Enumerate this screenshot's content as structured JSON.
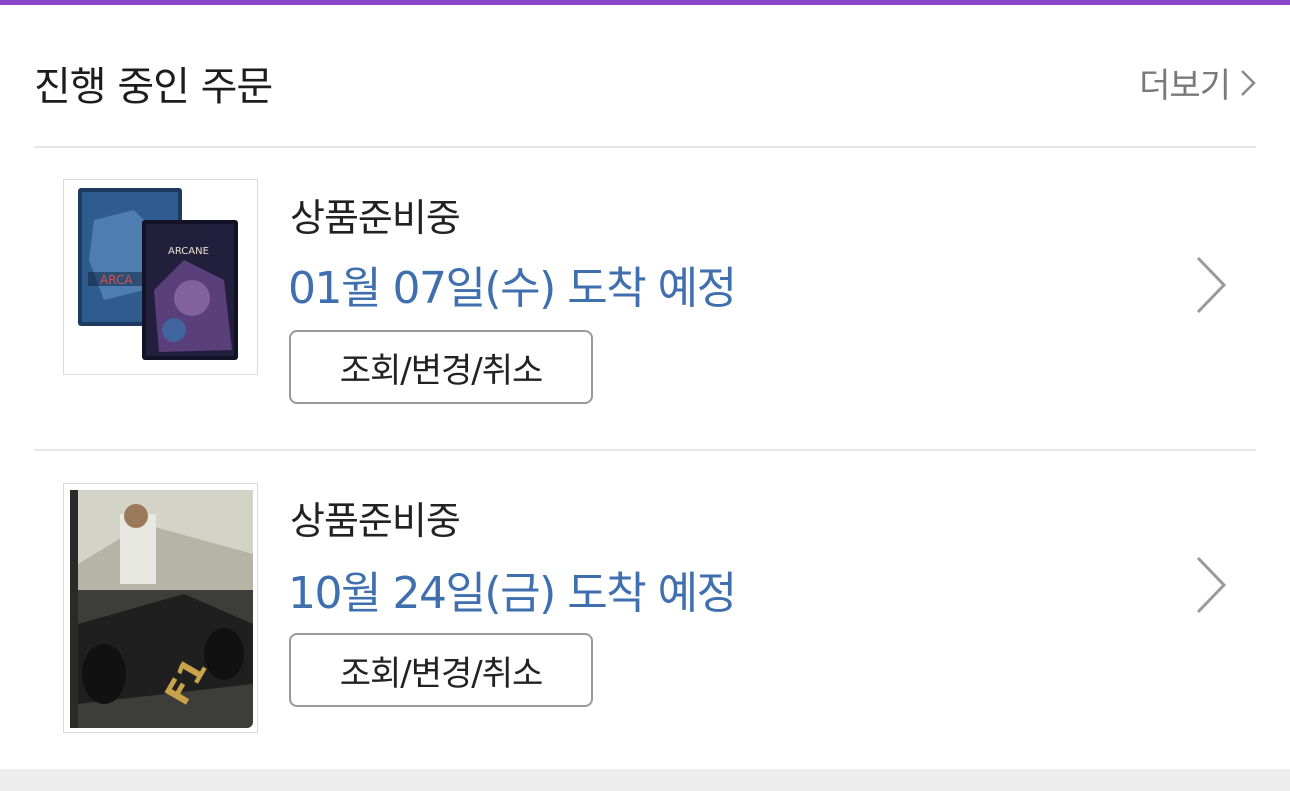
{
  "header": {
    "title": "진행 중인 주문",
    "more_label": "더보기"
  },
  "orders": [
    {
      "status": "상품준비중",
      "arrival": "01월 07일(수) 도착 예정",
      "action_label": "조회/변경/취소",
      "product_image": "arcane-steelbook-product-image"
    },
    {
      "status": "상품준비중",
      "arrival": "10월 24일(금) 도착 예정",
      "action_label": "조회/변경/취소",
      "product_image": "f1-the-movie-steelbook-product-image"
    }
  ],
  "colors": {
    "top_accent": "#8a45c8",
    "arrival_text": "#3f6fae",
    "muted_text": "#7a7a7a"
  },
  "icons": {
    "more": "chevron-right-icon",
    "row": "chevron-right-icon"
  }
}
